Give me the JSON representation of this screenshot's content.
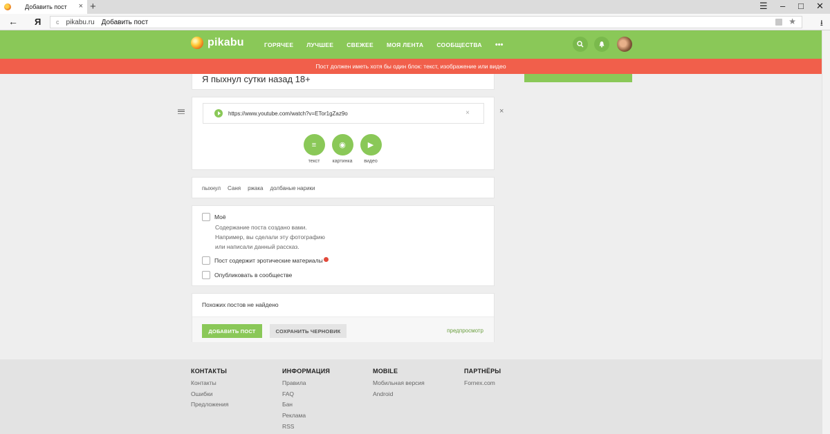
{
  "browser": {
    "tab_title": "Добавить пост",
    "tab_close": "×",
    "new_tab": "+",
    "window_controls": [
      "☰",
      "–",
      "□",
      "✕"
    ],
    "back": "←",
    "yandex": "Я",
    "reload": "c",
    "domain": "pikabu.ru",
    "page_title": "Добавить пост",
    "bookmark": "★",
    "download": "⭳"
  },
  "header": {
    "logo_text": "pikabu",
    "nav": [
      "ГОРЯЧЕЕ",
      "ЛУЧШЕЕ",
      "СВЕЖЕЕ",
      "МОЯ ЛЕНТА",
      "СООБЩЕСТВА"
    ],
    "more": "•••",
    "search_icon": "search-icon",
    "bell_icon": "bell-icon"
  },
  "error_message": "Пост должен иметь хотя бы один блок: текст, изображение или видео",
  "post": {
    "title": "Я пыхнул сутки назад 18+",
    "video_url": "https://www.youtube.com/watch?v=ETor1gZaz9o",
    "clear": "×",
    "remove_block": "×",
    "add_blocks": [
      {
        "label": "текст",
        "icon": "text-icon",
        "glyph": "≡"
      },
      {
        "label": "картинка",
        "icon": "camera-icon",
        "glyph": "◉"
      },
      {
        "label": "видео",
        "icon": "play-icon",
        "glyph": "▶"
      }
    ],
    "tags": [
      "пыхнул",
      "Саня",
      "ржака",
      "долбаные нарики"
    ]
  },
  "options": {
    "mine_label": "Моё",
    "mine_desc": [
      "Содержание поста создано вами.",
      "Например, вы сделали эту фотографию",
      "или написали данный рассказ."
    ],
    "erotic_label": "Пост содержит эротические материалы",
    "community_label": "Опубликовать в сообществе"
  },
  "similar": {
    "text": "Похожих постов не найдено",
    "add_button": "ДОБАВИТЬ ПОСТ",
    "draft_button": "СОХРАНИТЬ ЧЕРНОВИК",
    "preview_link": "предпросмотр"
  },
  "footer": {
    "columns": [
      {
        "title": "КОНТАКТЫ",
        "links": [
          "Контакты",
          "Ошибки",
          "Предложения"
        ]
      },
      {
        "title": "ИНФОРМАЦИЯ",
        "links": [
          "Правила",
          "FAQ",
          "Бан",
          "Реклама",
          "RSS"
        ]
      },
      {
        "title": "MOBILE",
        "links": [
          "Мобильная версия",
          "Android"
        ]
      },
      {
        "title": "ПАРТНЁРЫ",
        "links": [
          "Fornex.com"
        ]
      }
    ]
  },
  "colors": {
    "brand_green": "#8ac858",
    "error_red": "#f15f4b",
    "link_green": "#6a9e3e"
  }
}
